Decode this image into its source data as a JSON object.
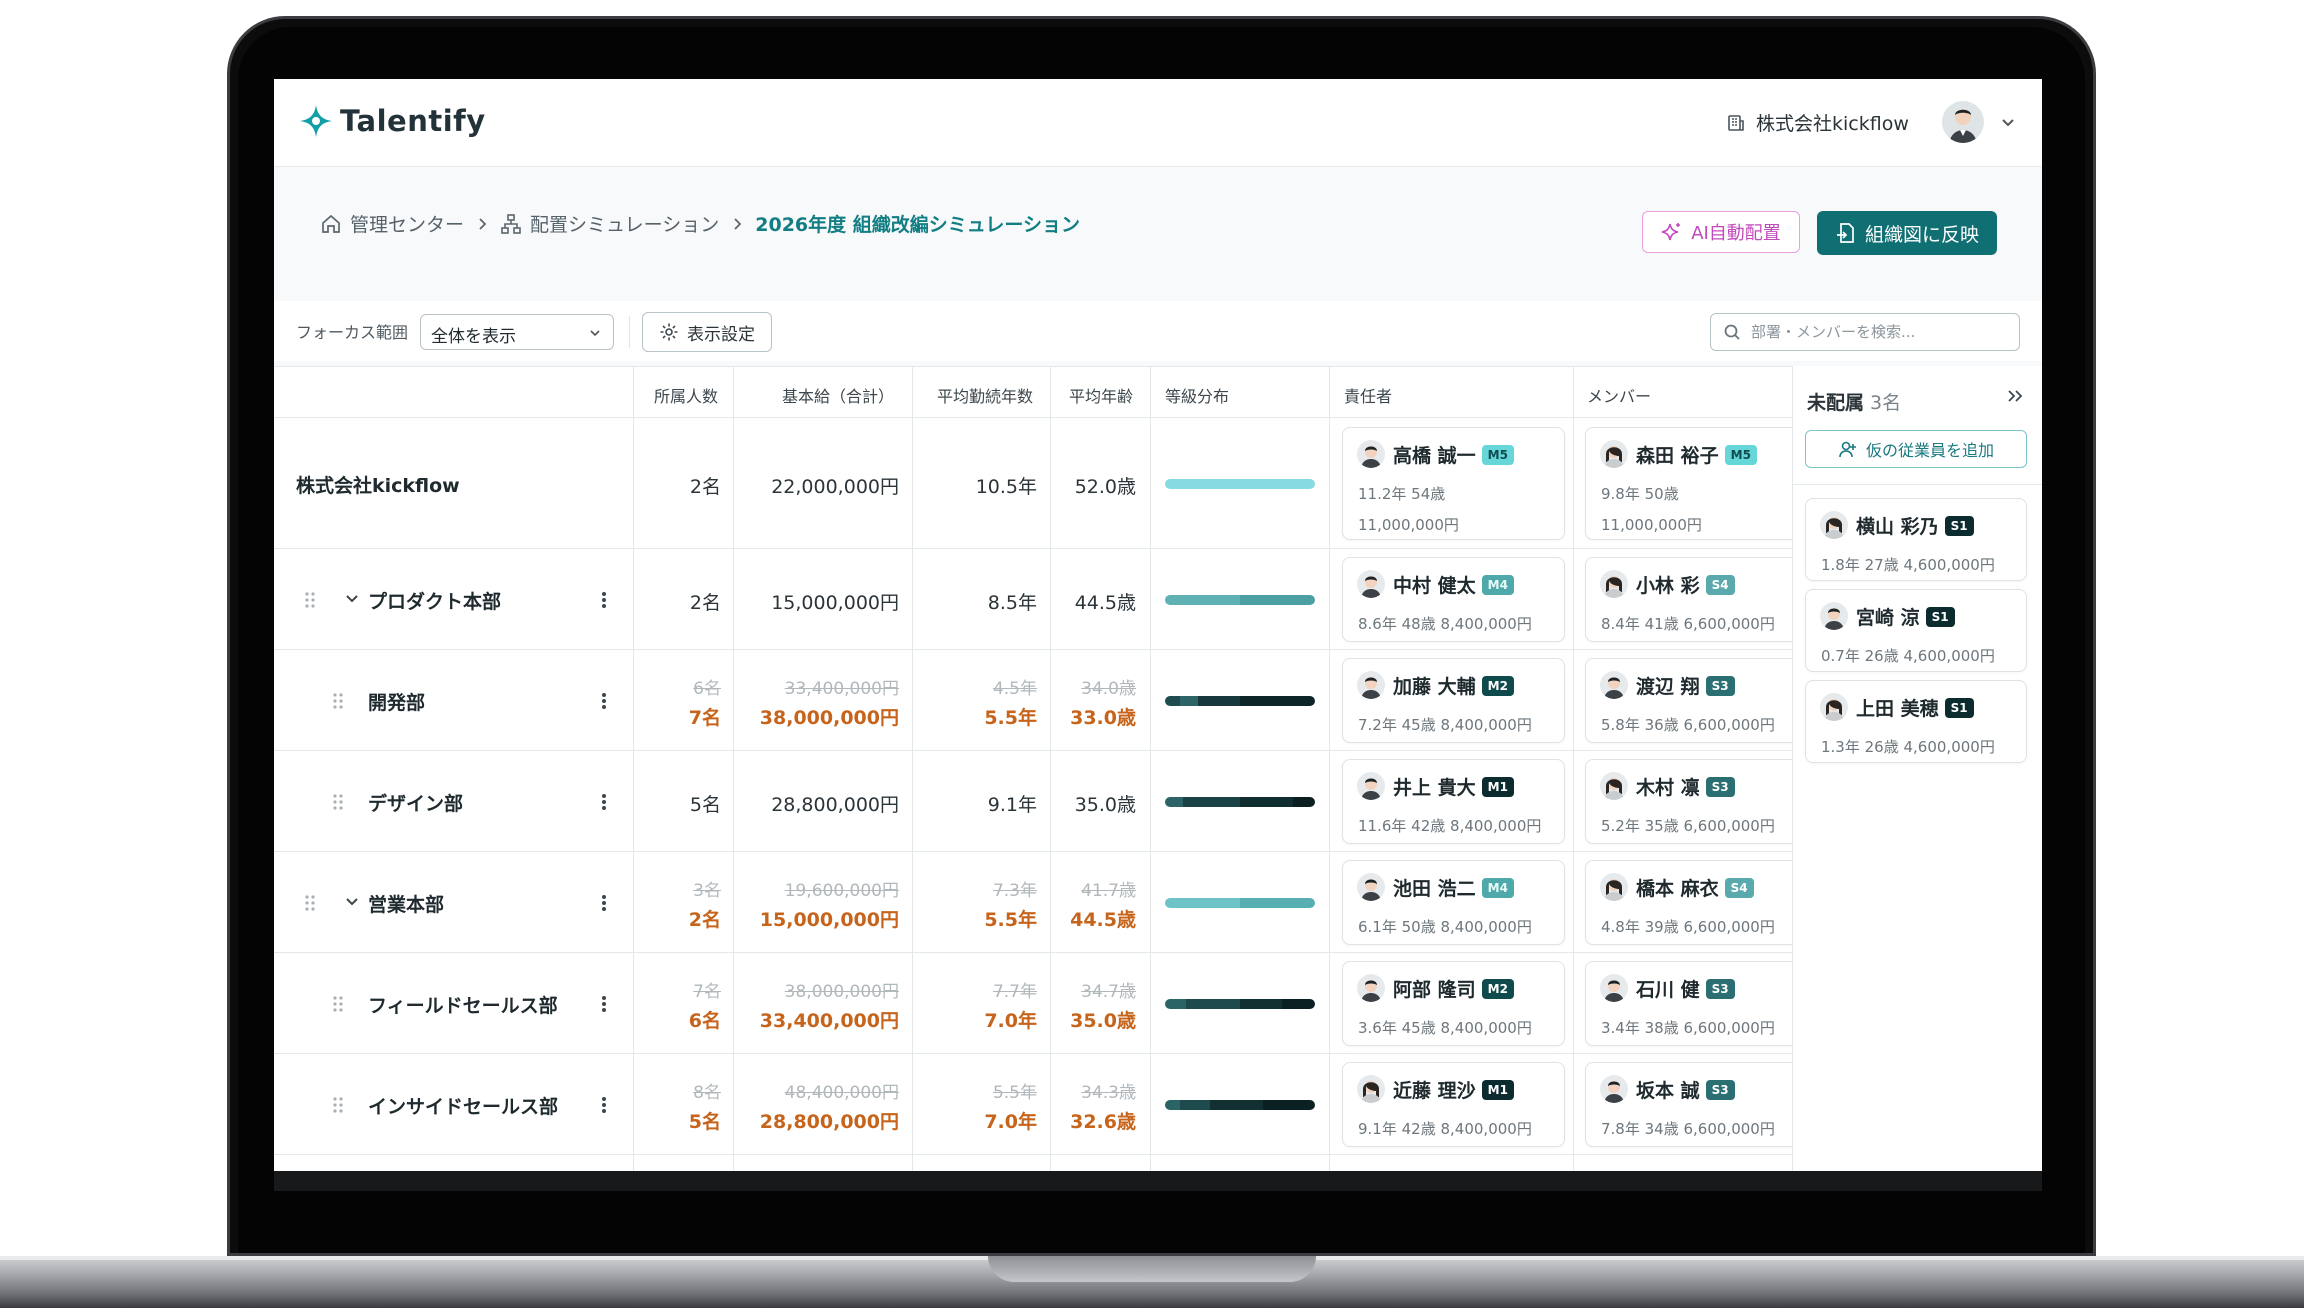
{
  "app": {
    "brand": "Talentify"
  },
  "header": {
    "company": "株式会社kickflow"
  },
  "breadcrumb": [
    {
      "label": "管理センター",
      "icon": "home-icon"
    },
    {
      "label": "配置シミュレーション",
      "icon": "org-chart-icon"
    },
    {
      "label": "2026年度 組織改編シミュレーション"
    }
  ],
  "actions": {
    "ai_label": "AI自動配置",
    "reflect_label": "組織図に反映"
  },
  "toolbar": {
    "focus_label": "フォーカス範囲",
    "focus_value": "全体を表示",
    "display_settings": "表示設定",
    "search_placeholder": "部署・メンバーを検索..."
  },
  "columns": [
    "所属人数",
    "基本給（合計）",
    "平均勤続年数",
    "平均年齢",
    "等級分布",
    "責任者",
    "メンバー"
  ],
  "rows": [
    {
      "name": "株式会社kickflow",
      "count": "2名",
      "salary": "22,000,000円",
      "tenure": "10.5年",
      "age": "52.0歳",
      "leader": {
        "name": "高橋 誠一",
        "grade": "M5",
        "meta1": "11.2年 54歳",
        "meta2": "11,000,000円"
      },
      "member": {
        "name": "森田 裕子",
        "grade": "M5",
        "meta1": "9.8年 50歳",
        "meta2": "11,000,000円"
      }
    },
    {
      "name": "プロダクト本部",
      "count": "2名",
      "salary": "15,000,000円",
      "tenure": "8.5年",
      "age": "44.5歳",
      "leader": {
        "name": "中村 健太",
        "grade": "M4",
        "meta1": "8.6年 48歳 8,400,000円"
      },
      "member": {
        "name": "小林 彩",
        "grade": "S4",
        "meta1": "8.4年 41歳 6,600,000円"
      }
    },
    {
      "name": "開発部",
      "count_old": "6名",
      "count": "7名",
      "salary_old": "33,400,000円",
      "salary": "38,000,000円",
      "tenure_old": "4.5年",
      "tenure": "5.5年",
      "age_old": "34.0歳",
      "age": "33.0歳",
      "leader": {
        "name": "加藤 大輔",
        "grade": "M2",
        "meta1": "7.2年 45歳 8,400,000円"
      },
      "member": {
        "name": "渡辺 翔",
        "grade": "S3",
        "meta1": "5.8年 36歳 6,600,000円"
      }
    },
    {
      "name": "デザイン部",
      "count": "5名",
      "salary": "28,800,000円",
      "tenure": "9.1年",
      "age": "35.0歳",
      "leader": {
        "name": "井上 貴大",
        "grade": "M1",
        "meta1": "11.6年 42歳 8,400,000円"
      },
      "member": {
        "name": "木村 凛",
        "grade": "S3",
        "meta1": "5.2年 35歳 6,600,000円"
      }
    },
    {
      "name": "営業本部",
      "count_old": "3名",
      "count": "2名",
      "salary_old": "19,600,000円",
      "salary": "15,000,000円",
      "tenure_old": "7.3年",
      "tenure": "5.5年",
      "age_old": "41.7歳",
      "age": "44.5歳",
      "leader": {
        "name": "池田 浩二",
        "grade": "M4",
        "meta1": "6.1年 50歳 8,400,000円"
      },
      "member": {
        "name": "橋本 麻衣",
        "grade": "S4",
        "meta1": "4.8年 39歳 6,600,000円"
      }
    },
    {
      "name": "フィールドセールス部",
      "count_old": "7名",
      "count": "6名",
      "salary_old": "38,000,000円",
      "salary": "33,400,000円",
      "tenure_old": "7.7年",
      "tenure": "7.0年",
      "age_old": "34.7歳",
      "age": "35.0歳",
      "leader": {
        "name": "阿部 隆司",
        "grade": "M2",
        "meta1": "3.6年 45歳 8,400,000円"
      },
      "member": {
        "name": "石川 健",
        "grade": "S3",
        "meta1": "3.4年 38歳 6,600,000円"
      }
    },
    {
      "name": "インサイドセールス部",
      "count_old": "8名",
      "count": "5名",
      "salary_old": "48,400,000円",
      "salary": "28,800,000円",
      "tenure_old": "5.5年",
      "tenure": "7.0年",
      "age_old": "34.3歳",
      "age": "32.6歳",
      "leader": {
        "name": "近藤 理沙",
        "grade": "M1",
        "meta1": "9.1年 42歳 8,400,000円"
      },
      "member": {
        "name": "坂本 誠",
        "grade": "S3",
        "meta1": "7.8年 34歳 6,600,000円"
      }
    }
  ],
  "unassigned": {
    "title": "未配属",
    "count": "3名",
    "add_label": "仮の従業員を追加",
    "people": [
      {
        "name": "横山 彩乃",
        "grade": "S1",
        "meta": "1.8年 27歳 4,600,000円"
      },
      {
        "name": "宮崎 涼",
        "grade": "S1",
        "meta": "0.7年 26歳 4,600,000円"
      },
      {
        "name": "上田 美穂",
        "grade": "S1",
        "meta": "1.3年 26歳 4,600,000円"
      }
    ]
  },
  "colors": {
    "brand": "#12a0a6",
    "primary": "#0f6f72",
    "changed": "#c7641b",
    "ai": "#c24abd"
  }
}
